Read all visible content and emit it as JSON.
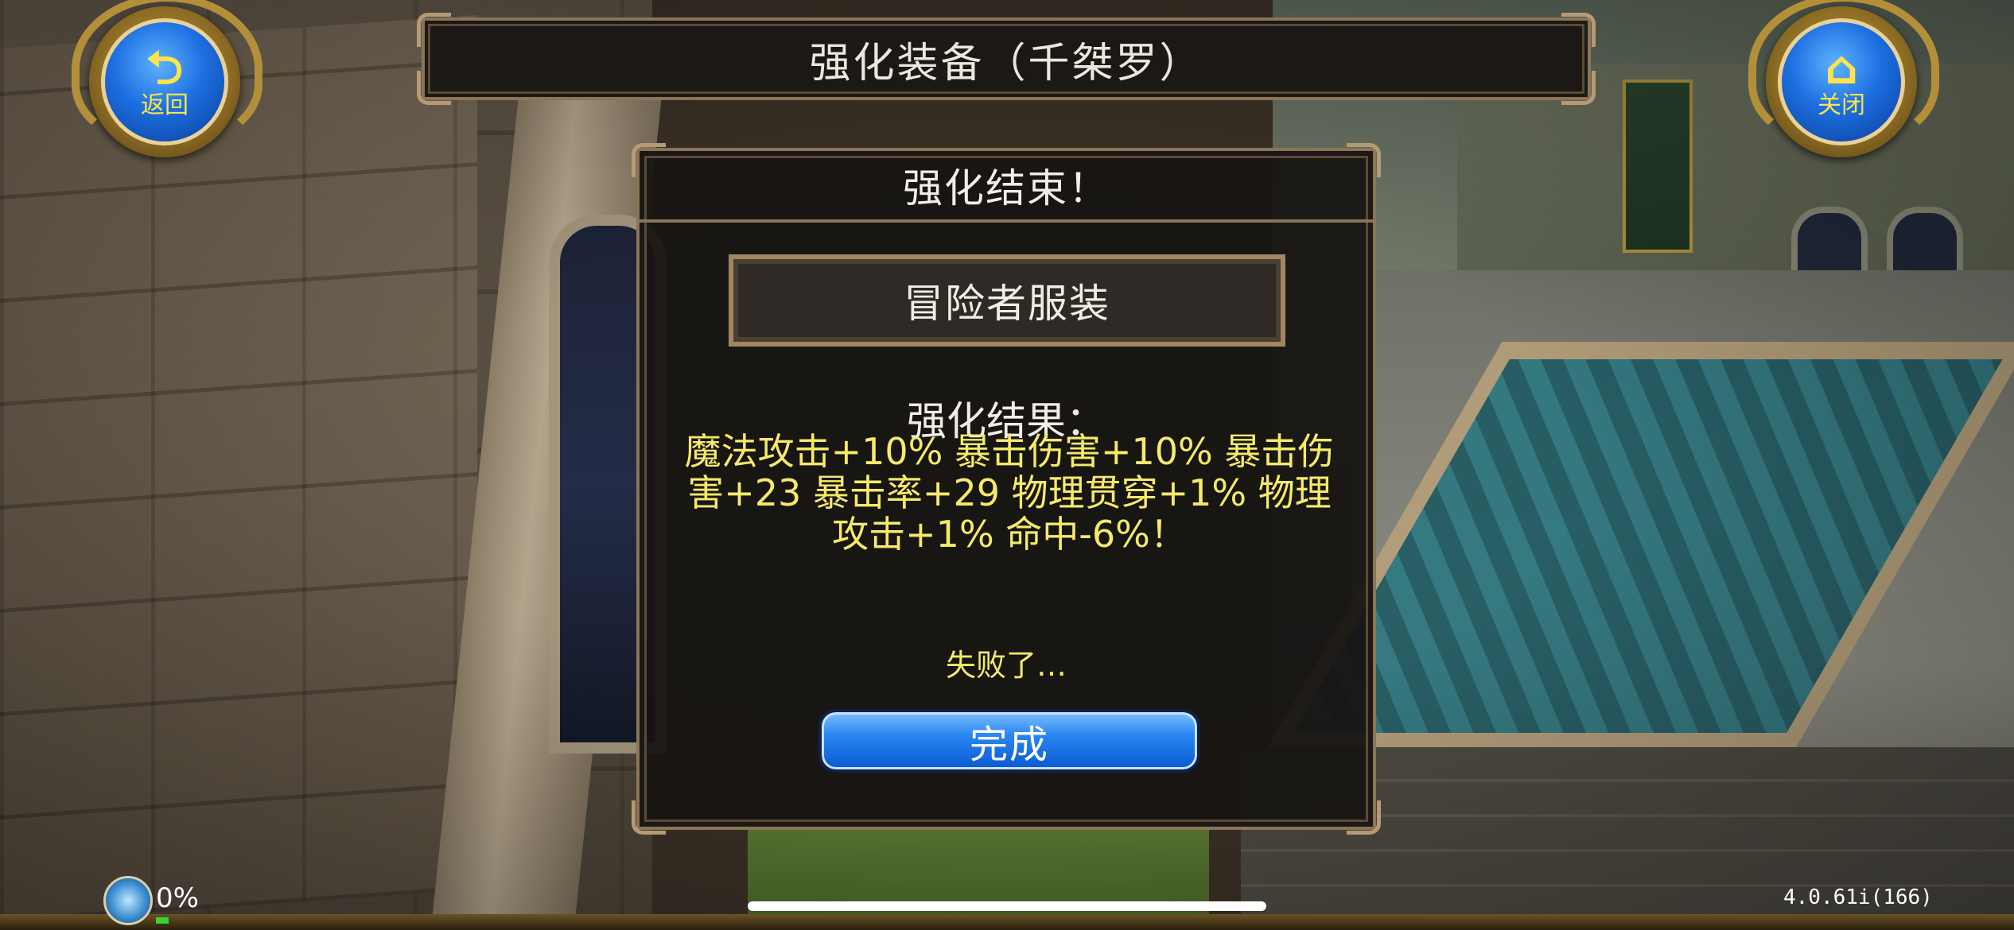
{
  "header": {
    "title": "强化装备（千桀罗）"
  },
  "back_button": {
    "icon": "return-arrow-icon",
    "label": "返回"
  },
  "close_button": {
    "icon": "home-icon",
    "label": "关闭"
  },
  "dialog": {
    "title": "强化结束！",
    "item_name": "冒险者服装",
    "result_label": "强化结果：",
    "result_text": "魔法攻击+10% 暴击伤害+10% 暴击伤害+23 暴击率+29 物理贯穿+1% 物理攻击+1% 命中-6%！",
    "status": "失败了…",
    "done_label": "完成"
  },
  "hud": {
    "exp_percent": "0%",
    "version": "4.0.61i(166)"
  },
  "colors": {
    "result_text": "#f5ea6a",
    "done_button": "#2a86f2",
    "round_button": "#1c6fe0"
  }
}
